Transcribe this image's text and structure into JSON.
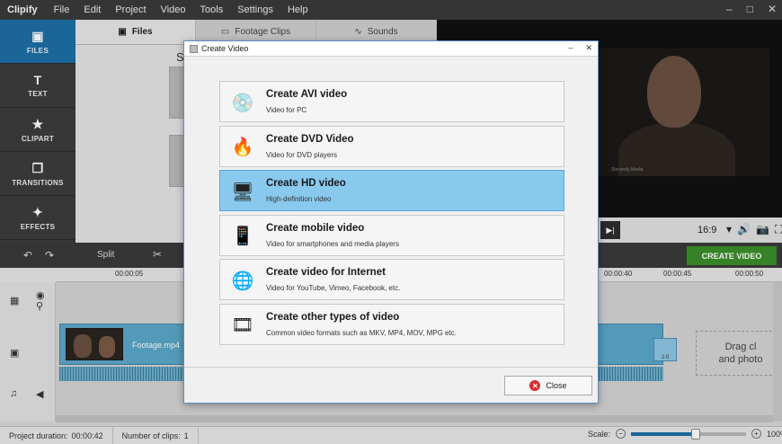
{
  "app": {
    "name": "Clipify",
    "menu": [
      "File",
      "Edit",
      "Project",
      "Video",
      "Tools",
      "Settings",
      "Help"
    ],
    "window_controls": [
      "–",
      "□",
      "✕"
    ]
  },
  "rail": [
    {
      "label": "FILES",
      "icon": "image-icon",
      "glyph": "▣"
    },
    {
      "label": "TEXT",
      "icon": "text-icon",
      "glyph": "T"
    },
    {
      "label": "CLIPART",
      "icon": "star-icon",
      "glyph": "★"
    },
    {
      "label": "TRANSITIONS",
      "icon": "transitions-icon",
      "glyph": "❐"
    },
    {
      "label": "EFFECTS",
      "icon": "magic-wand-icon",
      "glyph": "✦"
    }
  ],
  "media_tabs": [
    {
      "label": "Files",
      "icon": "image-icon",
      "glyph": "▣"
    },
    {
      "label": "Footage Clips",
      "icon": "film-icon",
      "glyph": "▭"
    },
    {
      "label": "Sounds",
      "icon": "waveform-icon",
      "glyph": "∿"
    }
  ],
  "media_heading": "S",
  "player": {
    "watermark": "Sincerely Media",
    "aspect": "16:9",
    "next_glyph": "▶|",
    "control_icons": [
      "▾",
      "🔊",
      "📷",
      "⛶"
    ]
  },
  "toolbar": {
    "undo": "↶",
    "redo": "↷",
    "split": "Split",
    "cut": "✂",
    "create_video": "CREATE VIDEO"
  },
  "ruler": {
    "ticks": [
      {
        "label": "00:00:05"
      },
      {
        "label": "00:00:40"
      },
      {
        "label": "00:00:45"
      },
      {
        "label": "00:00:50"
      }
    ]
  },
  "timeline": {
    "clip_name": "Footage.mp4",
    "mini_thumb_label": "2.0",
    "drop_text_1": "Drag cl",
    "drop_text_2": "and photo"
  },
  "status": {
    "duration_label": "Project duration:",
    "duration_value": "00:00:42",
    "clips_label": "Number of clips:",
    "clips_value": "1",
    "scale_label": "Scale:",
    "zoom_minus": "−",
    "zoom_plus": "+",
    "zoom_percent": "100%",
    "zoom_level": 0.56
  },
  "dialog": {
    "title": "Create Video",
    "controls": [
      "–",
      "✕"
    ],
    "options": [
      {
        "title": "Create AVI video",
        "desc": "Video for PC",
        "icon": "avi-disc-icon",
        "glyph": "💿",
        "selected": false
      },
      {
        "title": "Create DVD Video",
        "desc": "Video for DVD players",
        "icon": "dvd-icon",
        "glyph": "🔥",
        "selected": false
      },
      {
        "title": "Create HD video",
        "desc": "High-definition video",
        "icon": "monitor-icon",
        "glyph": "🖥",
        "selected": true
      },
      {
        "title": "Create mobile video",
        "desc": "Video for smartphones and media players",
        "icon": "mobile-phone-icon",
        "glyph": "📱",
        "selected": false
      },
      {
        "title": "Create video for Internet",
        "desc": "Video for YouTube, Vimeo, Facebook, etc.",
        "icon": "globe-icon",
        "glyph": "🌐",
        "selected": false
      },
      {
        "title": "Create other types of video",
        "desc": "Common video formats such as MKV, MP4, MOV, MPG etc.",
        "icon": "film-reel-icon",
        "glyph": "🎞",
        "selected": false
      }
    ],
    "close_label": "Close",
    "close_glyph": "✕"
  }
}
